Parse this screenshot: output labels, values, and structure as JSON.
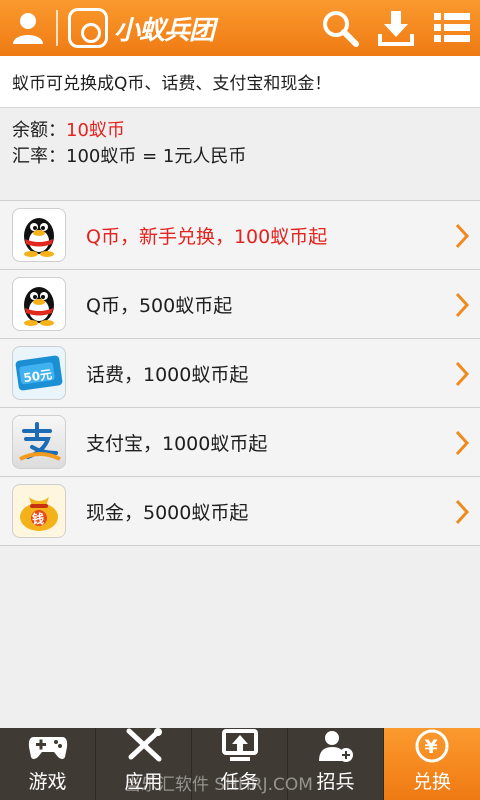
{
  "header": {
    "logo_text": "小蚁兵团"
  },
  "notice": "蚁币可兑换成Q币、话费、支付宝和现金！",
  "account": {
    "balance_label": "余额：",
    "balance_value": "10蚁币",
    "rate_text": "汇率：100蚁币 = 1元人民币"
  },
  "exchange_items": [
    {
      "label": "Q币，新手兑换，100蚁币起",
      "icon": "qq-penguin-icon",
      "highlight": true
    },
    {
      "label": "Q币，500蚁币起",
      "icon": "qq-penguin-icon",
      "highlight": false
    },
    {
      "label": "话费，1000蚁币起",
      "icon": "phone-card-icon",
      "card_text": "50元",
      "highlight": false
    },
    {
      "label": "支付宝，1000蚁币起",
      "icon": "alipay-icon",
      "highlight": false
    },
    {
      "label": "现金，5000蚁币起",
      "icon": "money-bag-icon",
      "bag_text": "钱",
      "highlight": false
    }
  ],
  "tabs": [
    {
      "label": "游戏",
      "icon": "gamepad-icon"
    },
    {
      "label": "应用",
      "icon": "tools-icon"
    },
    {
      "label": "任务",
      "icon": "upload-screen-icon"
    },
    {
      "label": "招兵",
      "icon": "add-user-icon"
    },
    {
      "label": "兑换",
      "icon": "yuan-coin-icon",
      "active": true
    }
  ],
  "watermark": "当乐汇软件 SHHRJ.COM",
  "colors": {
    "accent": "#f08a1e",
    "highlight_red": "#e3231f",
    "tabbar": "#3f3a33"
  }
}
